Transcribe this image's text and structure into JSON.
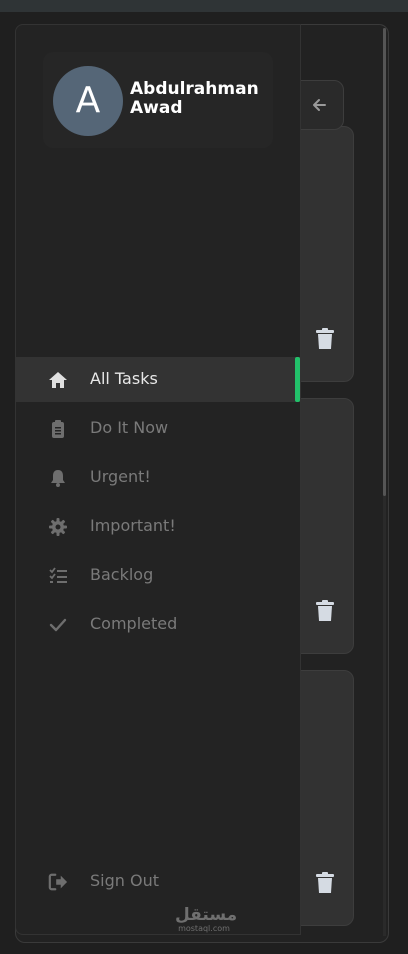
{
  "user": {
    "initial": "A",
    "name_line1": "Abdulrahman",
    "name_line2": "Awad"
  },
  "nav": {
    "items": [
      {
        "label": "All Tasks",
        "icon": "home-icon",
        "active": true
      },
      {
        "label": "Do It Now",
        "icon": "clipboard-icon",
        "active": false
      },
      {
        "label": "Urgent!",
        "icon": "bell-icon",
        "active": false
      },
      {
        "label": "Important!",
        "icon": "gear-icon",
        "active": false
      },
      {
        "label": "Backlog",
        "icon": "checklist-icon",
        "active": false
      },
      {
        "label": "Completed",
        "icon": "check-icon",
        "active": false
      }
    ],
    "sign_out": {
      "label": "Sign Out",
      "icon": "sign-out-icon"
    }
  },
  "toggle": {
    "icon": "arrow-left-icon"
  },
  "tasks": {
    "delete_icon": "trash-icon"
  },
  "watermark": {
    "arabic": "مستقل",
    "latin": "mostaql.com"
  },
  "colors": {
    "accent": "#22c06a",
    "background": "#1f1f1f",
    "sidebar": "#232323",
    "active_item": "#333333",
    "avatar": "#556677"
  }
}
